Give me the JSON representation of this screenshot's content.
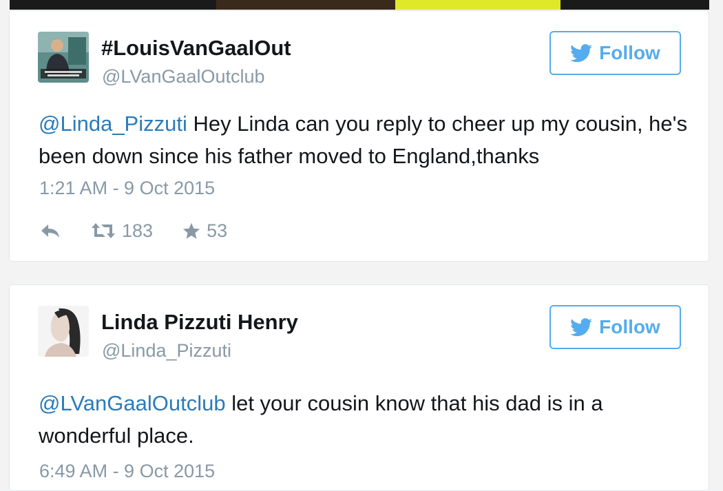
{
  "tweets": [
    {
      "author_name": "#LouisVanGaalOut",
      "author_handle": "@LVanGaalOutclub",
      "follow_label": "Follow",
      "mention": "@Linda_Pizzuti",
      "text": " Hey Linda can you reply to cheer up my cousin, he's been down since his father moved to England,thanks",
      "timestamp": "1:21 AM - 9 Oct 2015",
      "retweets": "183",
      "favorites": "53",
      "avatar_icon": "user-avatar-photo"
    },
    {
      "author_name": "Linda Pizzuti Henry",
      "author_handle": "@Linda_Pizzuti",
      "follow_label": "Follow",
      "mention": "@LVanGaalOutclub",
      "text": " let your cousin know that his dad is in a wonderful place.",
      "timestamp": "6:49 AM - 9 Oct 2015",
      "avatar_icon": "user-avatar-photo"
    }
  ],
  "icons": {
    "follow": "twitter-bird-icon",
    "reply": "reply-icon",
    "retweet": "retweet-icon",
    "favorite": "star-icon"
  },
  "colors": {
    "accent": "#55acee",
    "link": "#2b7bb9",
    "muted": "#8899a6",
    "text": "#14171a"
  }
}
